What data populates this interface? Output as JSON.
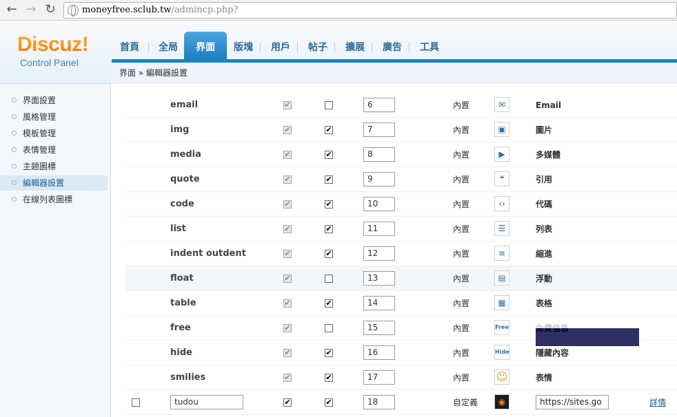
{
  "browser": {
    "url_host": "moneyfree.sclub.tw",
    "url_path": "/admincp.php?"
  },
  "logo": {
    "main": "Discuz!",
    "sub": "Control Panel"
  },
  "nav": {
    "tabs": [
      "首頁",
      "全局",
      "界面",
      "版塊",
      "用戶",
      "帖子",
      "擴展",
      "廣告",
      "工具"
    ],
    "active": "界面"
  },
  "breadcrumb": "界面 » 編輯器設置",
  "sidebar": {
    "items": [
      "界面設置",
      "風格管理",
      "模板管理",
      "表情管理",
      "主題圖標",
      "編輯器設置",
      "在線列表圖標"
    ],
    "active": "編輯器設置"
  },
  "rows": [
    {
      "tag": "email",
      "checked": false,
      "order": "6",
      "type": "內置",
      "icon": "email-icon",
      "label": "Email"
    },
    {
      "tag": "img",
      "checked": true,
      "order": "7",
      "type": "內置",
      "icon": "image-icon",
      "label": "圖片"
    },
    {
      "tag": "media",
      "checked": true,
      "order": "8",
      "type": "內置",
      "icon": "media-icon",
      "label": "多媒體"
    },
    {
      "tag": "quote",
      "checked": true,
      "order": "9",
      "type": "內置",
      "icon": "quote-icon",
      "label": "引用"
    },
    {
      "tag": "code",
      "checked": true,
      "order": "10",
      "type": "內置",
      "icon": "code-icon",
      "label": "代碼"
    },
    {
      "tag": "list",
      "checked": true,
      "order": "11",
      "type": "內置",
      "icon": "list-icon",
      "label": "列表"
    },
    {
      "tag": "indent outdent",
      "checked": true,
      "order": "12",
      "type": "內置",
      "icon": "indent-icon",
      "label": "縮進"
    },
    {
      "tag": "float",
      "checked": false,
      "order": "13",
      "type": "內置",
      "icon": "float-icon",
      "label": "浮動"
    },
    {
      "tag": "table",
      "checked": true,
      "order": "14",
      "type": "內置",
      "icon": "table-icon",
      "label": "表格"
    },
    {
      "tag": "free",
      "checked": false,
      "order": "15",
      "type": "內置",
      "icon": "free-icon",
      "label": "免費信息"
    },
    {
      "tag": "hide",
      "checked": true,
      "order": "16",
      "type": "內置",
      "icon": "hide-icon",
      "label": "隱藏內容"
    },
    {
      "tag": "smilies",
      "checked": true,
      "order": "17",
      "type": "內置",
      "icon": "smiley-icon",
      "label": "表情"
    }
  ],
  "custom_row": {
    "tag": "tudou",
    "order": "18",
    "type": "自定義",
    "label": "https://sites.go",
    "detail": "詳情"
  },
  "icon_glyphs": {
    "email-icon": "✉",
    "image-icon": "▣",
    "media-icon": "▶",
    "quote-icon": "❝",
    "code-icon": "‹›",
    "list-icon": "☰",
    "indent-icon": "≡",
    "float-icon": "▤",
    "table-icon": "▦",
    "free-icon": "Free",
    "hide-icon": "Hide",
    "smiley-icon": "☺"
  },
  "colors": {
    "accent": "#1c84c6",
    "logo_orange": "#f57200",
    "link": "#1c5d9c"
  }
}
